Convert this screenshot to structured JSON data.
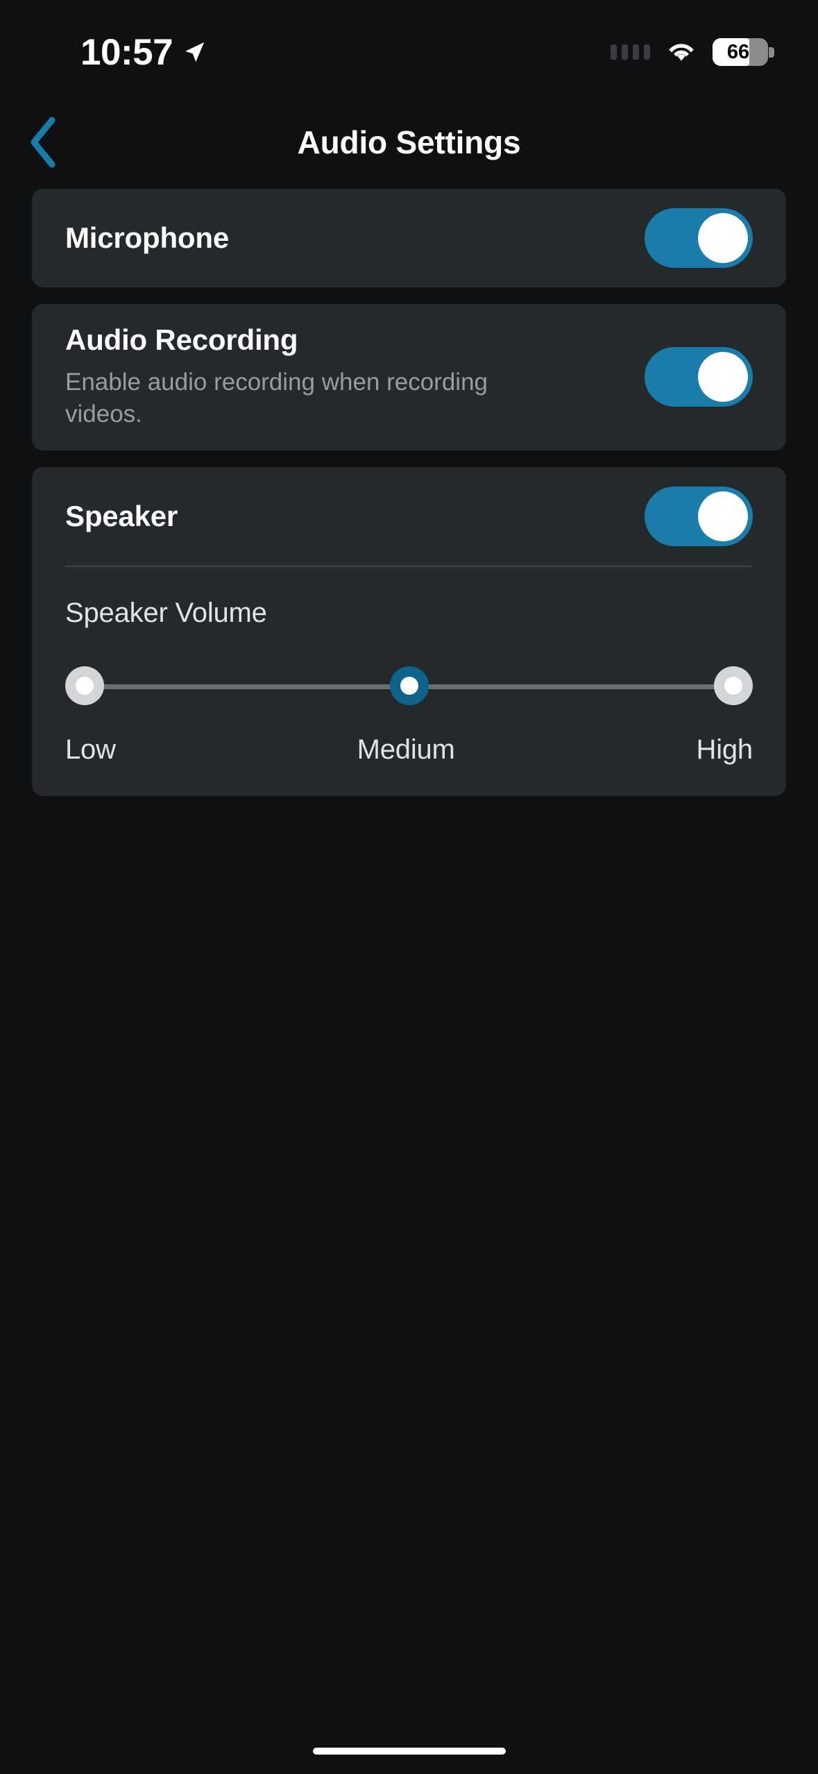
{
  "status_bar": {
    "time": "10:57",
    "location_icon": "location-arrow-icon",
    "signal_icon": "signal-dots-icon",
    "wifi_icon": "wifi-icon",
    "battery_level": "66",
    "battery_percent_value": 66
  },
  "nav": {
    "back_icon": "chevron-left-icon",
    "title": "Audio Settings",
    "accent_color": "#1a7cab"
  },
  "settings": {
    "microphone": {
      "title": "Microphone",
      "toggle_state": "on",
      "toggle_label": "Microphone toggle"
    },
    "audio_recording": {
      "title": "Audio Recording",
      "subtitle": "Enable audio recording when recording videos.",
      "toggle_state": "on",
      "toggle_label": "Audio Recording toggle"
    },
    "speaker": {
      "title": "Speaker",
      "toggle_state": "on",
      "toggle_label": "Speaker toggle",
      "volume": {
        "label": "Speaker Volume",
        "options": [
          "Low",
          "Medium",
          "High"
        ],
        "selected": "Medium",
        "selected_index": 1
      }
    }
  },
  "colors": {
    "page_background": "#0f1012",
    "card_background": "#24292c",
    "accent_blue": "#1a7cab",
    "slider_active": "#0d6389",
    "slider_idle": "#d4d5d6",
    "track": "#6a6f73",
    "primary_text": "#ffffff",
    "secondary_text": "#9b9c9e",
    "divider": "#3d4246"
  },
  "home_indicator": "home-indicator-bar"
}
